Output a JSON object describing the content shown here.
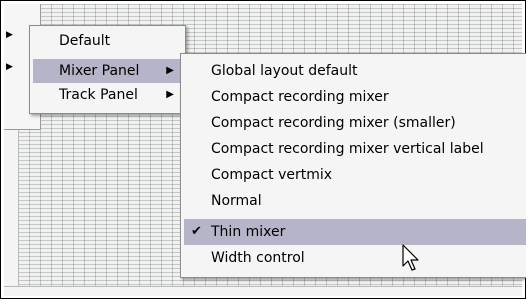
{
  "primary_menu": {
    "items": [
      {
        "label": "Default",
        "has_submenu": false,
        "highlighted": false
      },
      {
        "label": "Mixer Panel",
        "has_submenu": true,
        "highlighted": true
      },
      {
        "label": "Track Panel",
        "has_submenu": true,
        "highlighted": false
      }
    ]
  },
  "submenu": {
    "items": [
      {
        "label": "Global layout default",
        "checked": false
      },
      {
        "label": "Compact recording mixer",
        "checked": false
      },
      {
        "label": "Compact recording mixer (smaller)",
        "checked": false
      },
      {
        "label": "Compact recording mixer vertical label",
        "checked": false
      },
      {
        "label": "Compact vertmix",
        "checked": false
      },
      {
        "label": "Normal",
        "checked": false
      },
      {
        "label": "Thin mixer",
        "checked": true
      },
      {
        "label": "Width control",
        "checked": false
      }
    ],
    "highlighted_index": 6
  },
  "icons": {
    "check": "checkmark-icon",
    "submenu": "submenu-arrow-icon",
    "cursor": "mouse-pointer-icon"
  },
  "colors": {
    "highlight": "#b6b4c8",
    "menu_bg": "#f5f5f5",
    "grid_bg": "#f0f2f1"
  }
}
